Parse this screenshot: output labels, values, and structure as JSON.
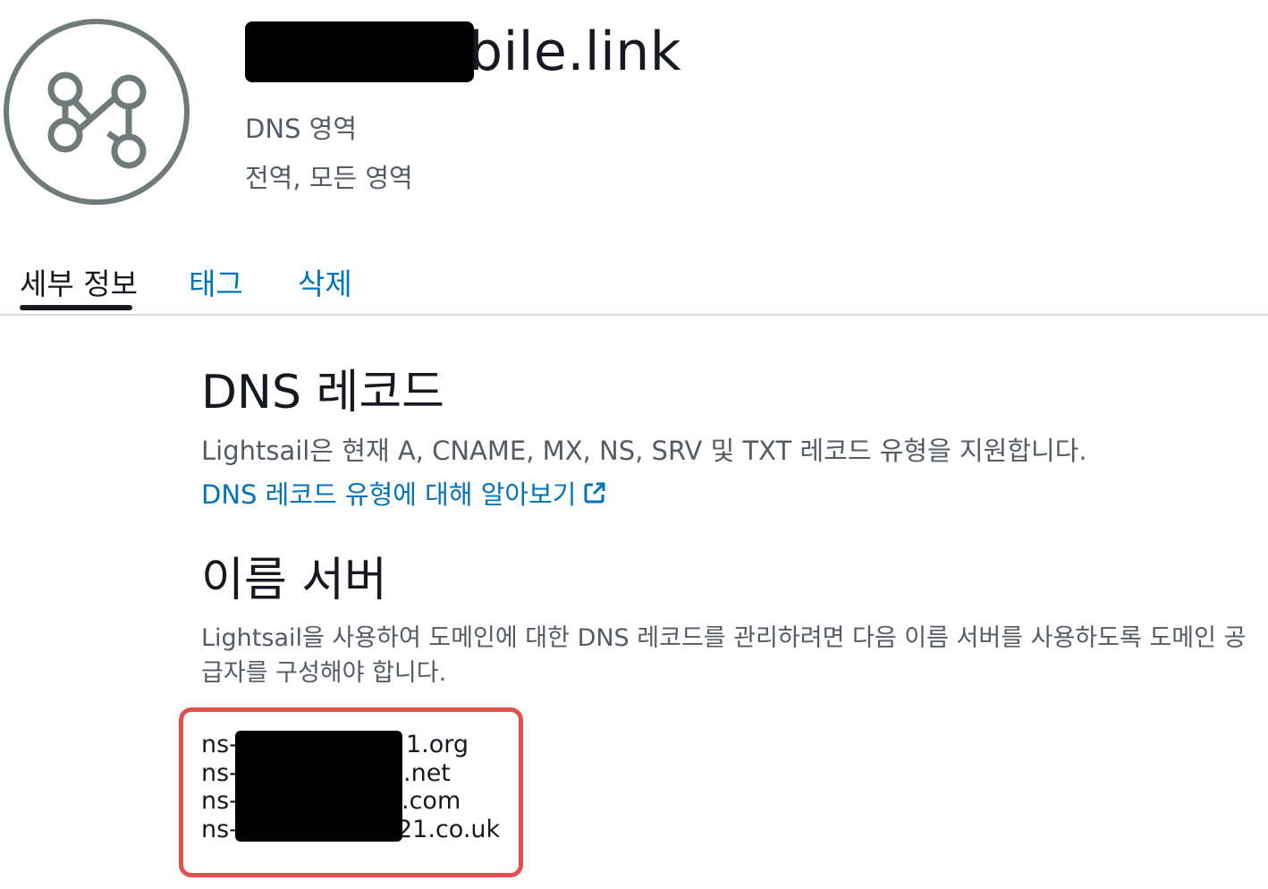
{
  "header": {
    "title_visible": "bile.link",
    "subtitle_type": "DNS 영역",
    "subtitle_scope": "전역, 모든 영역",
    "icon": "dns-zone-icon"
  },
  "tabs": [
    {
      "label": "세부 정보",
      "active": true
    },
    {
      "label": "태그",
      "active": false
    },
    {
      "label": "삭제",
      "active": false
    }
  ],
  "dns_records": {
    "heading": "DNS 레코드",
    "description": "Lightsail은 현재 A, CNAME, MX, NS, SRV 및 TXT 레코드 유형을 지원합니다.",
    "learn_more": "DNS 레코드 유형에 대해 알아보기",
    "learn_more_icon": "external-link-icon"
  },
  "name_servers": {
    "heading": "이름 서버",
    "description": "Lightsail을 사용하여 도메인에 대한 DNS 레코드를 관리하려면 다음 이름 서버를 사용하도록 도메인 공급자를 구성해야 합니다.",
    "servers": [
      {
        "prefix": "ns-",
        "suffix": "1.org"
      },
      {
        "prefix": "ns-",
        "suffix": ".net"
      },
      {
        "prefix": "ns-",
        "suffix": ".com"
      },
      {
        "prefix": "ns-",
        "suffix": "21.co.uk"
      }
    ]
  },
  "colors": {
    "accent_link": "#0073bb",
    "highlight_box": "#e2514e",
    "text_primary": "#16191f",
    "text_secondary": "#545b64"
  }
}
